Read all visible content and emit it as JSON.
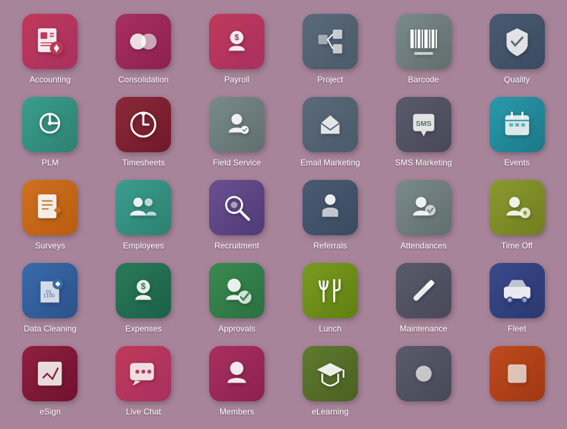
{
  "apps": [
    {
      "label": "Accounting",
      "color": "bg-pink",
      "icon": "accounting"
    },
    {
      "label": "Consolidation",
      "color": "bg-darkpink",
      "icon": "consolidation"
    },
    {
      "label": "Payroll",
      "color": "bg-pink",
      "icon": "payroll"
    },
    {
      "label": "Project",
      "color": "bg-slate",
      "icon": "project"
    },
    {
      "label": "Barcode",
      "color": "bg-gray",
      "icon": "barcode"
    },
    {
      "label": "Quality",
      "color": "bg-darkslate",
      "icon": "quality"
    },
    {
      "label": "PLM",
      "color": "bg-teal",
      "icon": "plm"
    },
    {
      "label": "Timesheets",
      "color": "bg-maroon",
      "icon": "timesheets"
    },
    {
      "label": "Field Service",
      "color": "bg-gray",
      "icon": "fieldservice"
    },
    {
      "label": "Email Marketing",
      "color": "bg-slate",
      "icon": "emailmarketing"
    },
    {
      "label": "SMS Marketing",
      "color": "bg-darkgray",
      "icon": "smsmarketing"
    },
    {
      "label": "Events",
      "color": "bg-cyan",
      "icon": "events"
    },
    {
      "label": "Surveys",
      "color": "bg-orange",
      "icon": "surveys"
    },
    {
      "label": "Employees",
      "color": "bg-teal",
      "icon": "employees"
    },
    {
      "label": "Recruitment",
      "color": "bg-purple",
      "icon": "recruitment"
    },
    {
      "label": "Referrals",
      "color": "bg-darkslate",
      "icon": "referrals"
    },
    {
      "label": "Attendances",
      "color": "bg-gray",
      "icon": "attendances"
    },
    {
      "label": "Time Off",
      "color": "bg-olive",
      "icon": "timeoff"
    },
    {
      "label": "Data Cleaning",
      "color": "bg-blue",
      "icon": "datacleaning"
    },
    {
      "label": "Expenses",
      "color": "bg-darkgreen",
      "icon": "expenses"
    },
    {
      "label": "Approvals",
      "color": "bg-green",
      "icon": "approvals"
    },
    {
      "label": "Lunch",
      "color": "bg-yellowgreen",
      "icon": "lunch"
    },
    {
      "label": "Maintenance",
      "color": "bg-darkgray",
      "icon": "maintenance"
    },
    {
      "label": "Fleet",
      "color": "bg-indigo",
      "icon": "fleet"
    },
    {
      "label": "eSign",
      "color": "bg-darkred",
      "icon": "esign"
    },
    {
      "label": "Live Chat",
      "color": "bg-pink",
      "icon": "livechat"
    },
    {
      "label": "Members",
      "color": "bg-darkpink",
      "icon": "members"
    },
    {
      "label": "eLearning",
      "color": "bg-moss",
      "icon": "elearning"
    },
    {
      "label": "",
      "color": "bg-darkgray",
      "icon": "blank"
    },
    {
      "label": "",
      "color": "bg-rust",
      "icon": "blank2"
    }
  ]
}
